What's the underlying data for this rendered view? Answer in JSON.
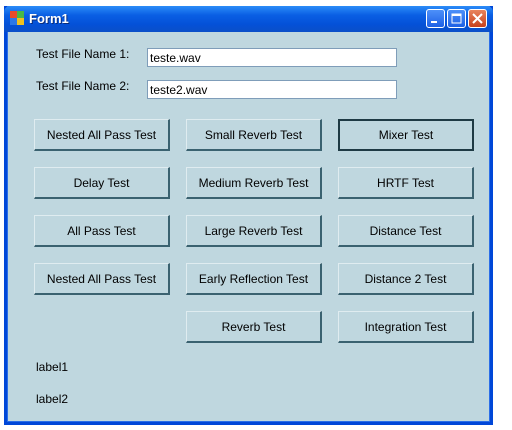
{
  "window": {
    "title": "Form1",
    "controls": {
      "minimize": "minimize-icon",
      "maximize": "maximize-icon",
      "close": "close-icon"
    }
  },
  "fields": {
    "file1": {
      "label": "Test File Name 1:",
      "value": "teste.wav"
    },
    "file2": {
      "label": "Test File Name 2:",
      "value": "teste2.wav"
    }
  },
  "buttons": {
    "nested_all_pass_1": "Nested All Pass Test",
    "small_reverb": "Small Reverb Test",
    "mixer": "Mixer Test",
    "delay": "Delay Test",
    "medium_reverb": "Medium Reverb Test",
    "hrtf": "HRTF Test",
    "all_pass": "All Pass Test",
    "large_reverb": "Large Reverb Test",
    "distance": "Distance Test",
    "nested_all_pass_2": "Nested All Pass Test",
    "early_reflection": "Early Reflection Test",
    "distance_2": "Distance 2 Test",
    "reverb": "Reverb Test",
    "integration": "Integration Test"
  },
  "labels": {
    "label1": "label1",
    "label2": "label2"
  },
  "colors": {
    "form_background": "#bfd7df",
    "titlebar": "#0451d8",
    "close_button": "#c8401c"
  }
}
